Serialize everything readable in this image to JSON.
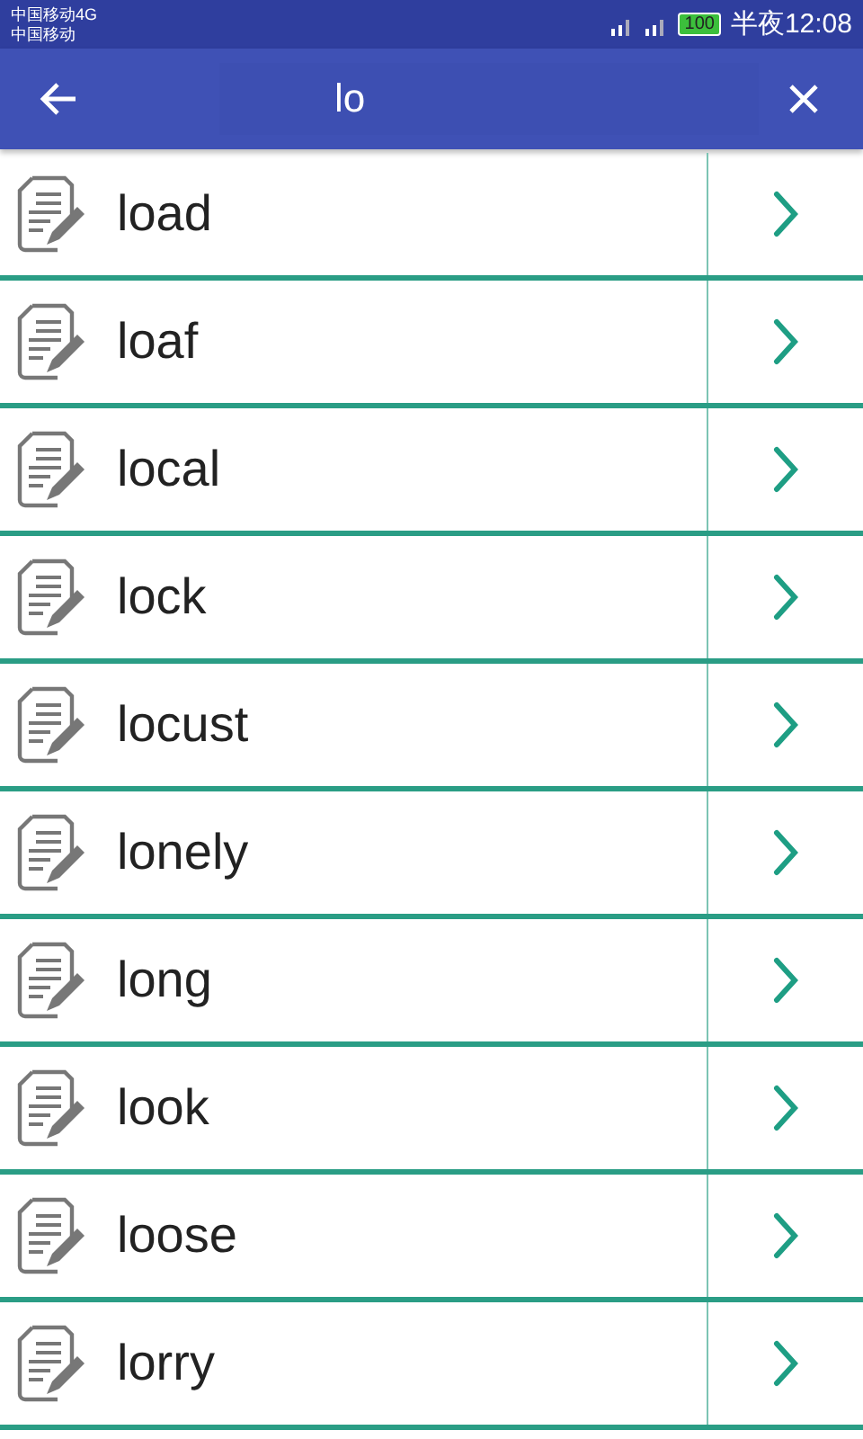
{
  "status_bar": {
    "carriers": [
      "中国移动4G",
      "中国移动"
    ],
    "battery": "100",
    "time": "半夜12:08"
  },
  "search": {
    "value": "lo"
  },
  "results": [
    {
      "word": "load"
    },
    {
      "word": "loaf"
    },
    {
      "word": "local"
    },
    {
      "word": "lock"
    },
    {
      "word": "locust"
    },
    {
      "word": "lonely"
    },
    {
      "word": "long"
    },
    {
      "word": "look"
    },
    {
      "word": "loose"
    },
    {
      "word": "lorry"
    }
  ]
}
